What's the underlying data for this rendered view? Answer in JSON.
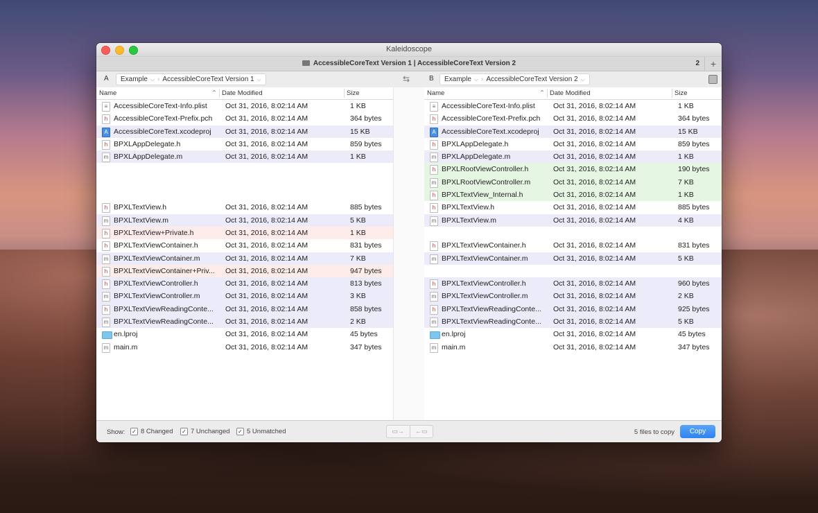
{
  "window": {
    "title": "Kaleidoscope"
  },
  "tab": {
    "title": "AccessibleCoreText Version 1 | AccessibleCoreText Version 2",
    "count": "2",
    "plus": "+"
  },
  "path": {
    "a_label": "A",
    "a_crumb1": "Example",
    "a_crumb2": "AccessibleCoreText Version 1",
    "b_label": "B",
    "b_crumb1": "Example",
    "b_crumb2": "AccessibleCoreText Version 2"
  },
  "columns": {
    "name": "Name",
    "date": "Date Modified",
    "size": "Size"
  },
  "pane_a": [
    {
      "name": "AccessibleCoreText-Info.plist",
      "date": "Oct 31, 2016, 8:02:14 AM",
      "size": "1 KB",
      "icon": "plist",
      "hl": ""
    },
    {
      "name": "AccessibleCoreText-Prefix.pch",
      "date": "Oct 31, 2016, 8:02:14 AM",
      "size": "364 bytes",
      "icon": "h",
      "hl": ""
    },
    {
      "name": "AccessibleCoreText.xcodeproj",
      "date": "Oct 31, 2016, 8:02:14 AM",
      "size": "15 KB",
      "icon": "proj",
      "hl": "purple"
    },
    {
      "name": "BPXLAppDelegate.h",
      "date": "Oct 31, 2016, 8:02:14 AM",
      "size": "859 bytes",
      "icon": "h",
      "hl": ""
    },
    {
      "name": "BPXLAppDelegate.m",
      "date": "Oct 31, 2016, 8:02:14 AM",
      "size": "1 KB",
      "icon": "m",
      "hl": "purple"
    },
    {
      "gap": true
    },
    {
      "gap": true
    },
    {
      "gap": true
    },
    {
      "name": "BPXLTextView.h",
      "date": "Oct 31, 2016, 8:02:14 AM",
      "size": "885 bytes",
      "icon": "h",
      "hl": ""
    },
    {
      "name": "BPXLTextView.m",
      "date": "Oct 31, 2016, 8:02:14 AM",
      "size": "5 KB",
      "icon": "m",
      "hl": "purple"
    },
    {
      "name": "BPXLTextView+Private.h",
      "date": "Oct 31, 2016, 8:02:14 AM",
      "size": "1 KB",
      "icon": "h",
      "hl": "pink"
    },
    {
      "name": "BPXLTextViewContainer.h",
      "date": "Oct 31, 2016, 8:02:14 AM",
      "size": "831 bytes",
      "icon": "h",
      "hl": ""
    },
    {
      "name": "BPXLTextViewContainer.m",
      "date": "Oct 31, 2016, 8:02:14 AM",
      "size": "7 KB",
      "icon": "m",
      "hl": "purple"
    },
    {
      "name": "BPXLTextViewContainer+Priv...",
      "date": "Oct 31, 2016, 8:02:14 AM",
      "size": "947 bytes",
      "icon": "h",
      "hl": "pink"
    },
    {
      "name": "BPXLTextViewController.h",
      "date": "Oct 31, 2016, 8:02:14 AM",
      "size": "813 bytes",
      "icon": "h",
      "hl": "purple"
    },
    {
      "name": "BPXLTextViewController.m",
      "date": "Oct 31, 2016, 8:02:14 AM",
      "size": "3 KB",
      "icon": "m",
      "hl": "purple"
    },
    {
      "name": "BPXLTextViewReadingConte...",
      "date": "Oct 31, 2016, 8:02:14 AM",
      "size": "858 bytes",
      "icon": "h",
      "hl": "purple"
    },
    {
      "name": "BPXLTextViewReadingConte...",
      "date": "Oct 31, 2016, 8:02:14 AM",
      "size": "2 KB",
      "icon": "m",
      "hl": "purple"
    },
    {
      "name": "en.lproj",
      "date": "Oct 31, 2016, 8:02:14 AM",
      "size": "45 bytes",
      "icon": "folder",
      "hl": ""
    },
    {
      "name": "main.m",
      "date": "Oct 31, 2016, 8:02:14 AM",
      "size": "347 bytes",
      "icon": "m",
      "hl": ""
    }
  ],
  "pane_b": [
    {
      "name": "AccessibleCoreText-Info.plist",
      "date": "Oct 31, 2016, 8:02:14 AM",
      "size": "1 KB",
      "icon": "plist",
      "hl": ""
    },
    {
      "name": "AccessibleCoreText-Prefix.pch",
      "date": "Oct 31, 2016, 8:02:14 AM",
      "size": "364 bytes",
      "icon": "h",
      "hl": ""
    },
    {
      "name": "AccessibleCoreText.xcodeproj",
      "date": "Oct 31, 2016, 8:02:14 AM",
      "size": "15 KB",
      "icon": "proj",
      "hl": "purple"
    },
    {
      "name": "BPXLAppDelegate.h",
      "date": "Oct 31, 2016, 8:02:14 AM",
      "size": "859 bytes",
      "icon": "h",
      "hl": ""
    },
    {
      "name": "BPXLAppDelegate.m",
      "date": "Oct 31, 2016, 8:02:14 AM",
      "size": "1 KB",
      "icon": "m",
      "hl": "purple"
    },
    {
      "name": "BPXLRootViewController.h",
      "date": "Oct 31, 2016, 8:02:14 AM",
      "size": "190 bytes",
      "icon": "h",
      "hl": "green"
    },
    {
      "name": "BPXLRootViewController.m",
      "date": "Oct 31, 2016, 8:02:14 AM",
      "size": "7 KB",
      "icon": "m",
      "hl": "green"
    },
    {
      "name": "BPXLTextView_Internal.h",
      "date": "Oct 31, 2016, 8:02:14 AM",
      "size": "1 KB",
      "icon": "h",
      "hl": "green"
    },
    {
      "name": "BPXLTextView.h",
      "date": "Oct 31, 2016, 8:02:14 AM",
      "size": "885 bytes",
      "icon": "h",
      "hl": ""
    },
    {
      "name": "BPXLTextView.m",
      "date": "Oct 31, 2016, 8:02:14 AM",
      "size": "4 KB",
      "icon": "m",
      "hl": "purple"
    },
    {
      "gap": true
    },
    {
      "name": "BPXLTextViewContainer.h",
      "date": "Oct 31, 2016, 8:02:14 AM",
      "size": "831 bytes",
      "icon": "h",
      "hl": ""
    },
    {
      "name": "BPXLTextViewContainer.m",
      "date": "Oct 31, 2016, 8:02:14 AM",
      "size": "5 KB",
      "icon": "m",
      "hl": "purple"
    },
    {
      "gap": true
    },
    {
      "name": "BPXLTextViewController.h",
      "date": "Oct 31, 2016, 8:02:14 AM",
      "size": "960 bytes",
      "icon": "h",
      "hl": "purple"
    },
    {
      "name": "BPXLTextViewController.m",
      "date": "Oct 31, 2016, 8:02:14 AM",
      "size": "2 KB",
      "icon": "m",
      "hl": "purple"
    },
    {
      "name": "BPXLTextViewReadingConte...",
      "date": "Oct 31, 2016, 8:02:14 AM",
      "size": "925 bytes",
      "icon": "h",
      "hl": "purple"
    },
    {
      "name": "BPXLTextViewReadingConte...",
      "date": "Oct 31, 2016, 8:02:14 AM",
      "size": "5 KB",
      "icon": "m",
      "hl": "purple"
    },
    {
      "name": "en.lproj",
      "date": "Oct 31, 2016, 8:02:14 AM",
      "size": "45 bytes",
      "icon": "folder",
      "hl": ""
    },
    {
      "name": "main.m",
      "date": "Oct 31, 2016, 8:02:14 AM",
      "size": "347 bytes",
      "icon": "m",
      "hl": ""
    }
  ],
  "footer": {
    "show_label": "Show:",
    "changed": "8 Changed",
    "unchanged": "7 Unchanged",
    "unmatched": "5 Unmatched",
    "to_copy": "5 files to copy",
    "copy_button": "Copy"
  },
  "colors": {
    "changed": "#ecebfa",
    "added": "#e5f6e3",
    "removed": "#fdecea",
    "accent": "#2e82f0"
  }
}
